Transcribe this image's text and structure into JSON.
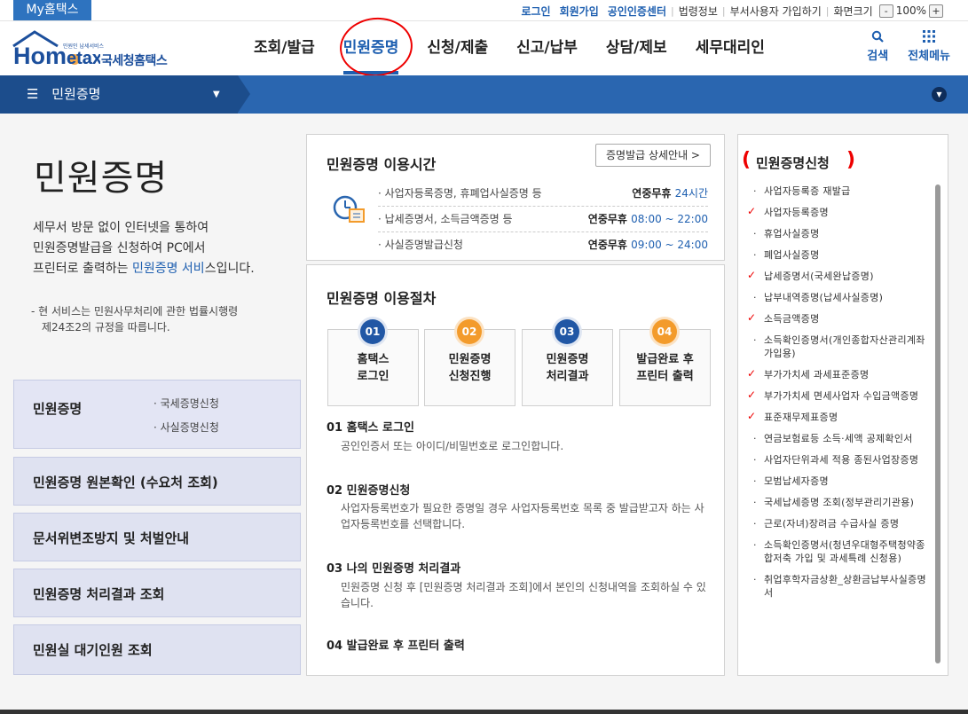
{
  "util": {
    "my_tab": "My홈택스",
    "links": [
      {
        "label": "로그인",
        "blue": true
      },
      {
        "label": "회원가입",
        "blue": true
      },
      {
        "label": "공인인증센터",
        "blue": true
      },
      {
        "label": "법령정보",
        "blue": false
      },
      {
        "label": "부서사용자 가입하기",
        "blue": false
      },
      {
        "label": "화면크기",
        "blue": false
      }
    ],
    "zoom_minus": "-",
    "zoom_value": "100%",
    "zoom_plus": "+"
  },
  "logo": {
    "word": "Hometax",
    "tagline": "민원인 납세서비스",
    "brand": "국세청홈택스"
  },
  "gnb": {
    "menus": [
      {
        "label": "조회/발급",
        "active": false
      },
      {
        "label": "민원증명",
        "active": true
      },
      {
        "label": "신청/제출",
        "active": false
      },
      {
        "label": "신고/납부",
        "active": false
      },
      {
        "label": "상담/제보",
        "active": false
      },
      {
        "label": "세무대리인",
        "active": false
      }
    ],
    "search_label": "검색",
    "all_menu_label": "전체메뉴"
  },
  "subbar": {
    "title": "민원증명"
  },
  "left": {
    "title": "민원증명",
    "desc_line1": "세무서 방문 없이 인터넷을 통하여",
    "desc_line2": "민원증명발급을 신청하여 PC에서",
    "desc_line3_pre": "프린터로 출력하는 ",
    "desc_line3_link": "민원증명 서비",
    "desc_line3_post": "스입니다.",
    "note_line1": "- 현 서비스는 민원사무처리에 관한 법률시행령",
    "note_line2": "제24조2의 규정을 따릅니다.",
    "boxes": [
      {
        "label": "민원증명",
        "subs": [
          "· 국세증명신청",
          "· 사실증명신청"
        ]
      },
      {
        "label": "민원증명 원본확인 (수요처 조회)"
      },
      {
        "label": "문서위변조방지 및 처벌안내"
      },
      {
        "label": "민원증명 처리결과 조회"
      },
      {
        "label": "민원실 대기인원 조회"
      }
    ]
  },
  "hours": {
    "title": "민원증명 이용시간",
    "detail_button": "증명발급 상세안내 >",
    "rows": [
      {
        "item": "· 사업자등록증명, 휴폐업사실증명 등",
        "pre": "연중무휴 ",
        "time": "24시간"
      },
      {
        "item": "· 납세증명서, 소득금액증명 등",
        "pre": "연중무휴 ",
        "time": "08:00 ~ 22:00"
      },
      {
        "item": "· 사실증명발급신청",
        "pre": "연중무휴 ",
        "time": "09:00 ~ 24:00"
      }
    ]
  },
  "procedure": {
    "title": "민원증명 이용절차",
    "steps": [
      {
        "num": "01",
        "line1": "홈택스",
        "line2": "로그인",
        "color": "blue"
      },
      {
        "num": "02",
        "line1": "민원증명",
        "line2": "신청진행",
        "color": "orange"
      },
      {
        "num": "03",
        "line1": "민원증명",
        "line2": "처리결과",
        "color": "blue"
      },
      {
        "num": "04",
        "line1": "발급완료 후",
        "line2": "프린터 출력",
        "color": "orange"
      }
    ],
    "sections": [
      {
        "heading": "01 홈택스 로그인",
        "text": "공인인증서 또는 아이디/비밀번호로 로그인합니다."
      },
      {
        "heading": "02 민원증명신청",
        "text": "사업자등록번호가 필요한 증명일 경우 사업자등록번호 목록 중 발급받고자 하는 사업자등록번호를 선택합니다."
      },
      {
        "heading": "03 나의 민원증명 처리결과",
        "text": "민원증명 신청 후 [민원증명 처리결과 조회]에서 본인의 신청내역을 조회하실 수 있습니다."
      },
      {
        "heading": "04 발급완료 후 프린터 출력",
        "text": ""
      }
    ]
  },
  "right": {
    "title": "민원증명신청",
    "items": [
      {
        "label": "사업자등록증 재발급",
        "checked": false
      },
      {
        "label": "사업자등록증명",
        "checked": true
      },
      {
        "label": "휴업사실증명",
        "checked": false
      },
      {
        "label": "폐업사실증명",
        "checked": false
      },
      {
        "label": "납세증명서(국세완납증명)",
        "checked": true
      },
      {
        "label": "납부내역증명(납세사실증명)",
        "checked": false
      },
      {
        "label": "소득금액증명",
        "checked": true
      },
      {
        "label": "소득확인증명서(개인종합자산관리계좌 가입용)",
        "checked": false
      },
      {
        "label": "부가가치세 과세표준증명",
        "checked": true
      },
      {
        "label": "부가가치세 면세사업자 수입금액증명",
        "checked": true
      },
      {
        "label": "표준재무제표증명",
        "checked": true
      },
      {
        "label": "연금보험료등 소득·세액 공제확인서",
        "checked": false
      },
      {
        "label": "사업자단위과세 적용 종된사업장증명",
        "checked": false
      },
      {
        "label": "모범납세자증명",
        "checked": false
      },
      {
        "label": "국세납세증명 조회(정부관리기관용)",
        "checked": false
      },
      {
        "label": "근로(자녀)장려금 수급사실 증명",
        "checked": false
      },
      {
        "label": "소득확인증명서(청년우대형주택청약종합저축 가입 및 과세특례 신청용)",
        "checked": false
      },
      {
        "label": "취업후학자금상환_상환금납부사실증명서",
        "checked": false
      }
    ]
  },
  "colors": {
    "brand_blue": "#1e5fb0",
    "subbar_blue": "#2a66b0",
    "orange": "#f39b2b",
    "annotation_red": "#e00000"
  }
}
